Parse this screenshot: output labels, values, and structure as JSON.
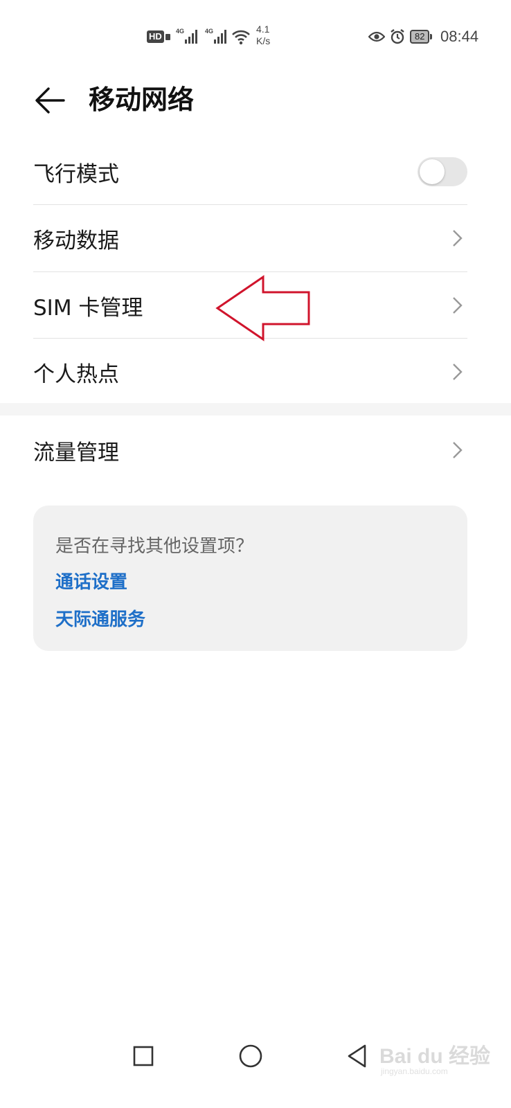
{
  "status_bar": {
    "hd": "HD",
    "signal1_label": "4G",
    "signal2_label": "4G",
    "speed_value": "4.1",
    "speed_unit": "K/s",
    "battery": "82",
    "time": "08:44"
  },
  "header": {
    "title": "移动网络"
  },
  "settings": {
    "airplane_mode": {
      "label": "飞行模式",
      "enabled": false
    },
    "mobile_data": {
      "label": "移动数据"
    },
    "sim_management": {
      "label": "SIM 卡管理"
    },
    "hotspot": {
      "label": "个人热点"
    },
    "data_usage": {
      "label": "流量管理"
    }
  },
  "suggestions": {
    "question": "是否在寻找其他设置项？",
    "links": [
      "通话设置",
      "天际通服务"
    ]
  },
  "watermark": {
    "logo": "Bai du 经验",
    "sub": "jingyan.baidu.com"
  },
  "colors": {
    "link": "#1e6fc8",
    "annotation_arrow": "#d0142c",
    "toggle_off": "#e6e6e6"
  }
}
